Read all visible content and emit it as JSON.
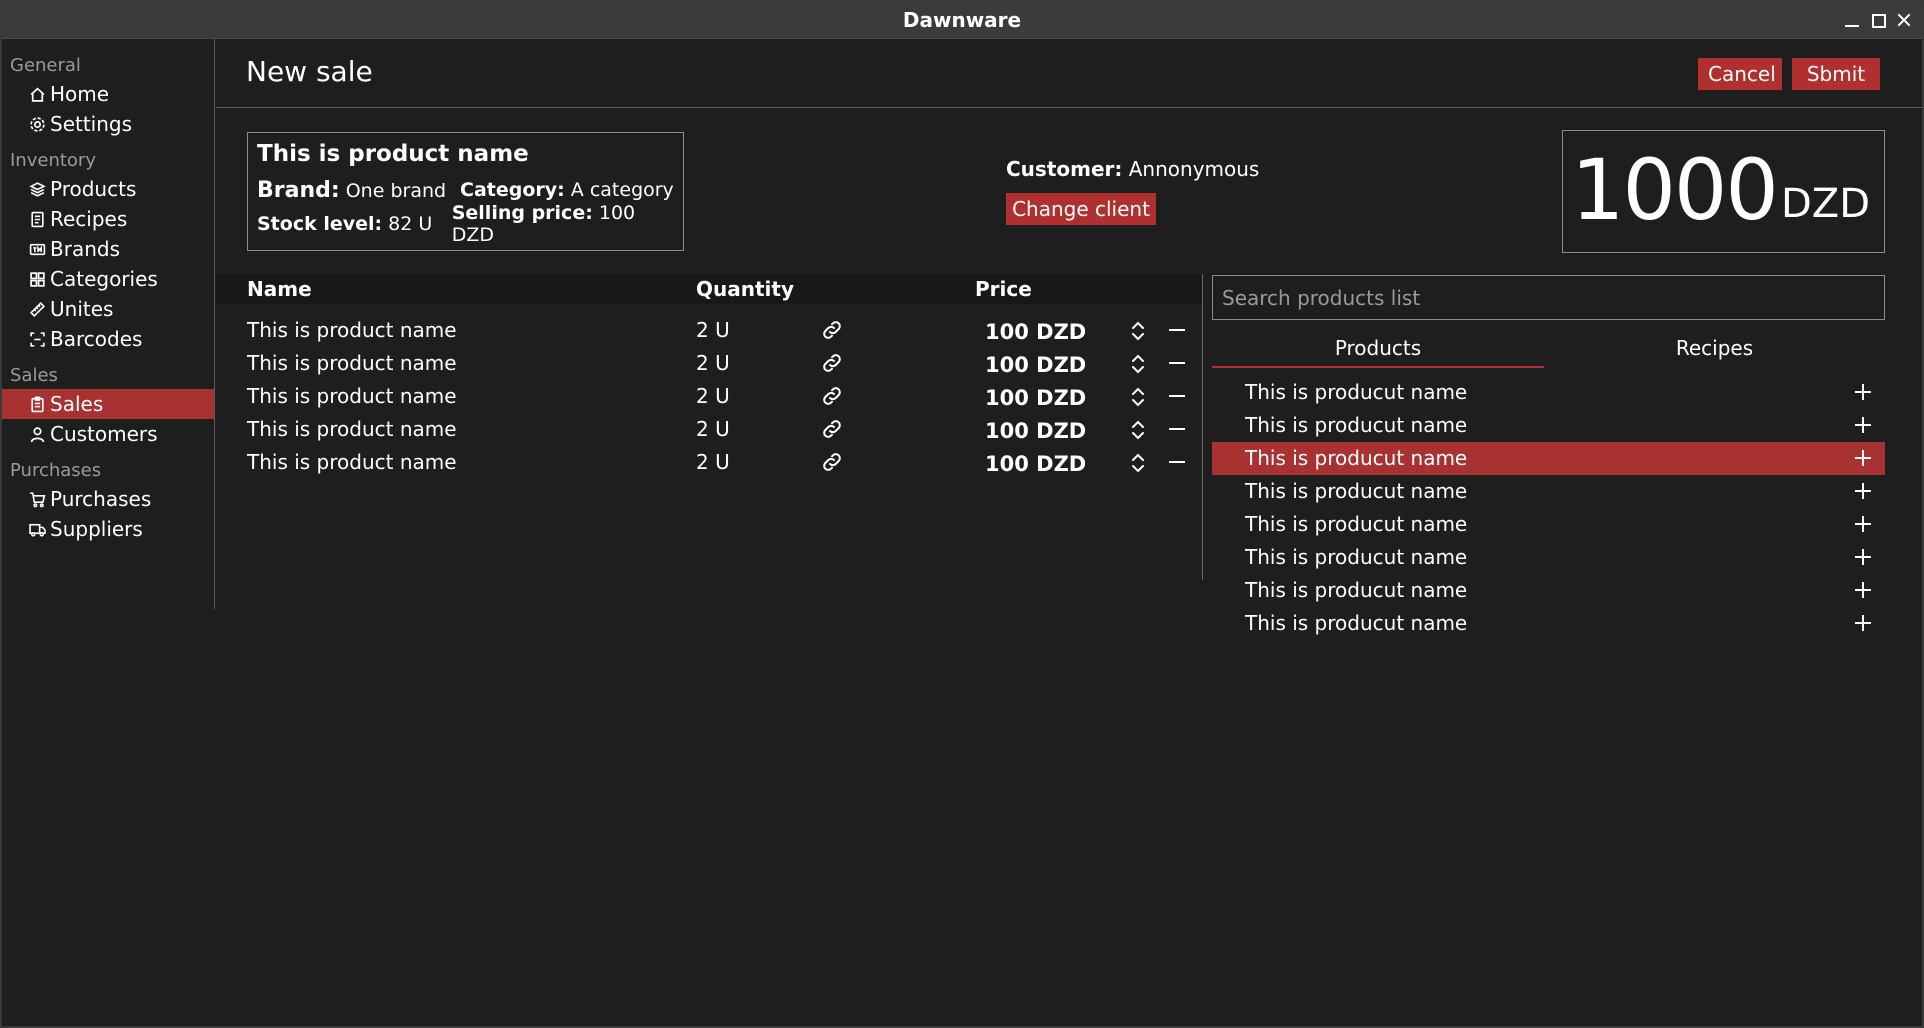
{
  "window": {
    "title": "Dawnware"
  },
  "sidebar": {
    "sections": [
      {
        "label": "General",
        "items": [
          {
            "label": "Home",
            "icon": "home-icon"
          },
          {
            "label": "Settings",
            "icon": "gear-icon"
          }
        ]
      },
      {
        "label": "Inventory",
        "items": [
          {
            "label": "Products",
            "icon": "layers-icon"
          },
          {
            "label": "Recipes",
            "icon": "receipt-icon"
          },
          {
            "label": "Brands",
            "icon": "trademark-icon"
          },
          {
            "label": "Categories",
            "icon": "grid-icon"
          },
          {
            "label": "Unites",
            "icon": "ruler-icon"
          },
          {
            "label": "Barcodes",
            "icon": "barcode-scan-icon"
          }
        ]
      },
      {
        "label": "Sales",
        "items": [
          {
            "label": "Sales",
            "icon": "clipboard-icon",
            "active": true
          },
          {
            "label": "Customers",
            "icon": "user-icon"
          }
        ]
      },
      {
        "label": "Purchases",
        "items": [
          {
            "label": "Purchases",
            "icon": "cart-icon"
          },
          {
            "label": "Suppliers",
            "icon": "truck-icon"
          }
        ]
      }
    ]
  },
  "header": {
    "title": "New sale",
    "cancel_label": "Cancel",
    "submit_label": "Sbmit"
  },
  "product_card": {
    "name": "This is product name",
    "brand_key": "Brand:",
    "brand_value": "One brand",
    "category_key": "Category:",
    "category_value": "A category",
    "stock_key": "Stock level:",
    "stock_value": "82 U",
    "price_key": "Selling price:",
    "price_value": "100 DZD"
  },
  "customer": {
    "key": "Customer:",
    "value": "Annonymous",
    "change_label": "Change client"
  },
  "total": {
    "amount": "1000",
    "currency": "DZD"
  },
  "sale_table": {
    "headers": {
      "name": "Name",
      "quantity": "Quantity",
      "price": "Price"
    },
    "rows": [
      {
        "name": "This is product name",
        "quantity": "2 U",
        "price": "100 DZD"
      },
      {
        "name": "This is product name",
        "quantity": "2 U",
        "price": "100 DZD"
      },
      {
        "name": "This is product name",
        "quantity": "2 U",
        "price": "100 DZD"
      },
      {
        "name": "This is product name",
        "quantity": "2 U",
        "price": "100 DZD"
      },
      {
        "name": "This is product name",
        "quantity": "2 U",
        "price": "100 DZD"
      }
    ]
  },
  "product_panel": {
    "search_placeholder": "Search products list",
    "tabs": [
      {
        "label": "Products",
        "active": true
      },
      {
        "label": "Recipes",
        "active": false
      }
    ],
    "items": [
      {
        "name": "This is producut name"
      },
      {
        "name": "This is producut name"
      },
      {
        "name": "This is producut name",
        "selected": true
      },
      {
        "name": "This is producut name"
      },
      {
        "name": "This is producut name"
      },
      {
        "name": "This is producut name"
      },
      {
        "name": "This is producut name"
      },
      {
        "name": "This is producut name"
      }
    ]
  },
  "colors": {
    "accent": "#b03030",
    "background": "#1e1e1e",
    "titlebar": "#3b3b3b"
  }
}
